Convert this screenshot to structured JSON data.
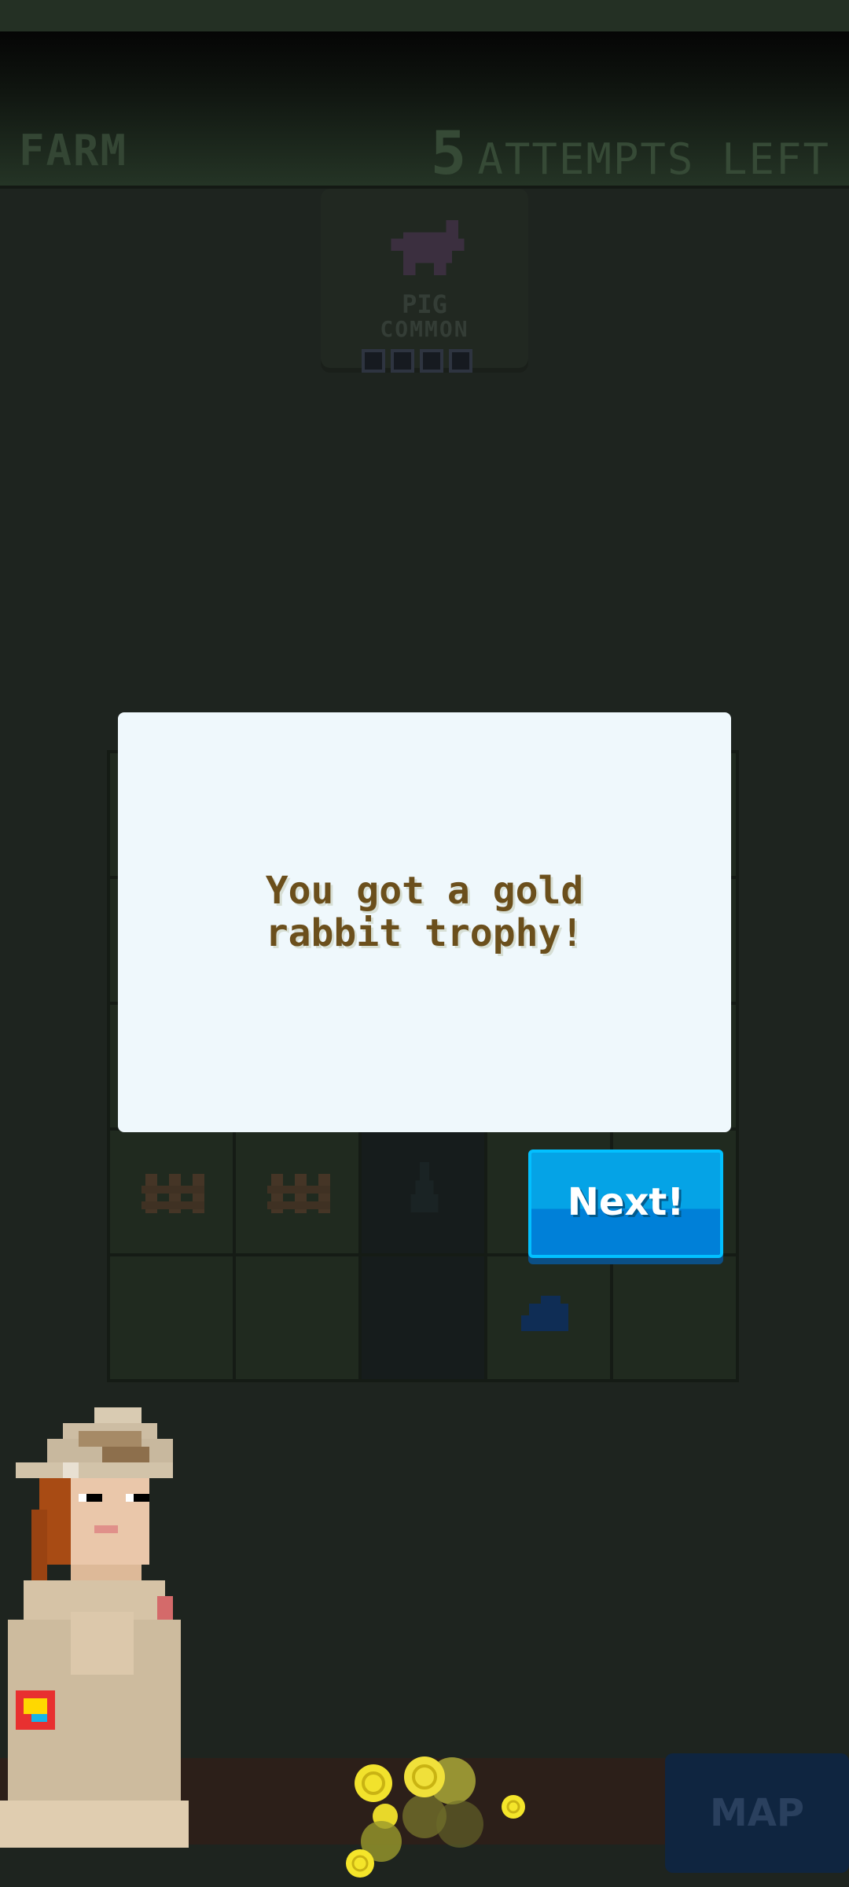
{
  "header": {
    "area_name": "FARM",
    "attempts_count": "5",
    "attempts_label": "ATTEMPTS LEFT"
  },
  "target_card": {
    "animal_name": "PIG",
    "rarity": "COMMON",
    "icon": "pig-icon",
    "progress_slots_filled": 0,
    "progress_slots_total": 4
  },
  "dialog": {
    "message_line1": "You got a gold",
    "message_line2": "rabbit trophy!",
    "next_button_label": "Next!"
  },
  "bottom_bar": {
    "map_button_label": "MAP"
  },
  "colors": {
    "dialog_text": "#6b4f1c",
    "next_button": "#05a3e6",
    "background": "#1e241f"
  }
}
